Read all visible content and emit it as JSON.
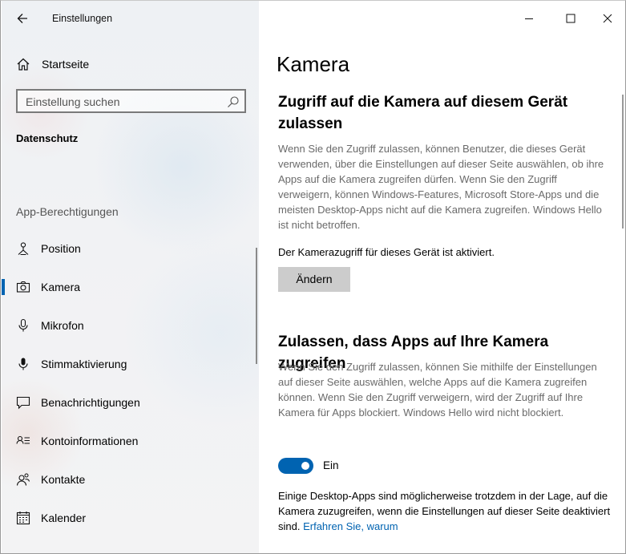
{
  "window": {
    "app_title": "Einstellungen",
    "controls": [
      "minimize",
      "maximize",
      "close"
    ]
  },
  "sidebar": {
    "home_label": "Startseite",
    "search_placeholder": "Einstellung suchen",
    "section_title": "Datenschutz",
    "group_title": "App-Berechtigungen",
    "items": [
      {
        "label": "Position",
        "icon": "location-icon"
      },
      {
        "label": "Kamera",
        "icon": "camera-icon",
        "active": true
      },
      {
        "label": "Mikrofon",
        "icon": "microphone-icon"
      },
      {
        "label": "Stimmaktivierung",
        "icon": "voice-activation-icon"
      },
      {
        "label": "Benachrichtigungen",
        "icon": "notifications-icon"
      },
      {
        "label": "Kontoinformationen",
        "icon": "account-info-icon"
      },
      {
        "label": "Kontakte",
        "icon": "contacts-icon"
      },
      {
        "label": "Kalender",
        "icon": "calendar-icon"
      }
    ]
  },
  "main": {
    "page_title": "Kamera",
    "device_section": {
      "heading": "Zugriff auf die Kamera auf diesem Gerät zulassen",
      "description": "Wenn Sie den Zugriff zulassen, können Benutzer, die dieses Gerät verwenden, über die Einstellungen auf dieser Seite auswählen, ob ihre Apps auf die Kamera zugreifen dürfen. Wenn Sie den Zugriff verweigern, können Windows-Features, Microsoft Store-Apps und die meisten Desktop-Apps nicht auf die Kamera zugreifen. Windows Hello ist nicht betroffen.",
      "status": "Der Kamerazugriff für dieses Gerät ist aktiviert.",
      "change_button": "Ändern"
    },
    "apps_section": {
      "heading": "Zulassen, dass Apps auf Ihre Kamera zugreifen",
      "description": "Wenn Sie den Zugriff zulassen, können Sie mithilfe der Einstellungen auf dieser Seite auswählen, welche Apps auf die Kamera zugreifen können. Wenn Sie den Zugriff verweigern, wird der Zugriff auf Ihre Kamera für Apps blockiert. Windows Hello wird nicht blockiert.",
      "toggle_state": "Ein",
      "toggle_on": true,
      "note": "Einige Desktop-Apps sind möglicherweise trotzdem in der Lage, auf die Kamera zuzugreifen, wenn die Einstellungen auf dieser Seite deaktiviert sind.",
      "note_link": "Erfahren Sie, warum"
    }
  },
  "colors": {
    "accent": "#0063b1",
    "button_bg": "#cccccc",
    "description_text": "#6a6a6a"
  }
}
